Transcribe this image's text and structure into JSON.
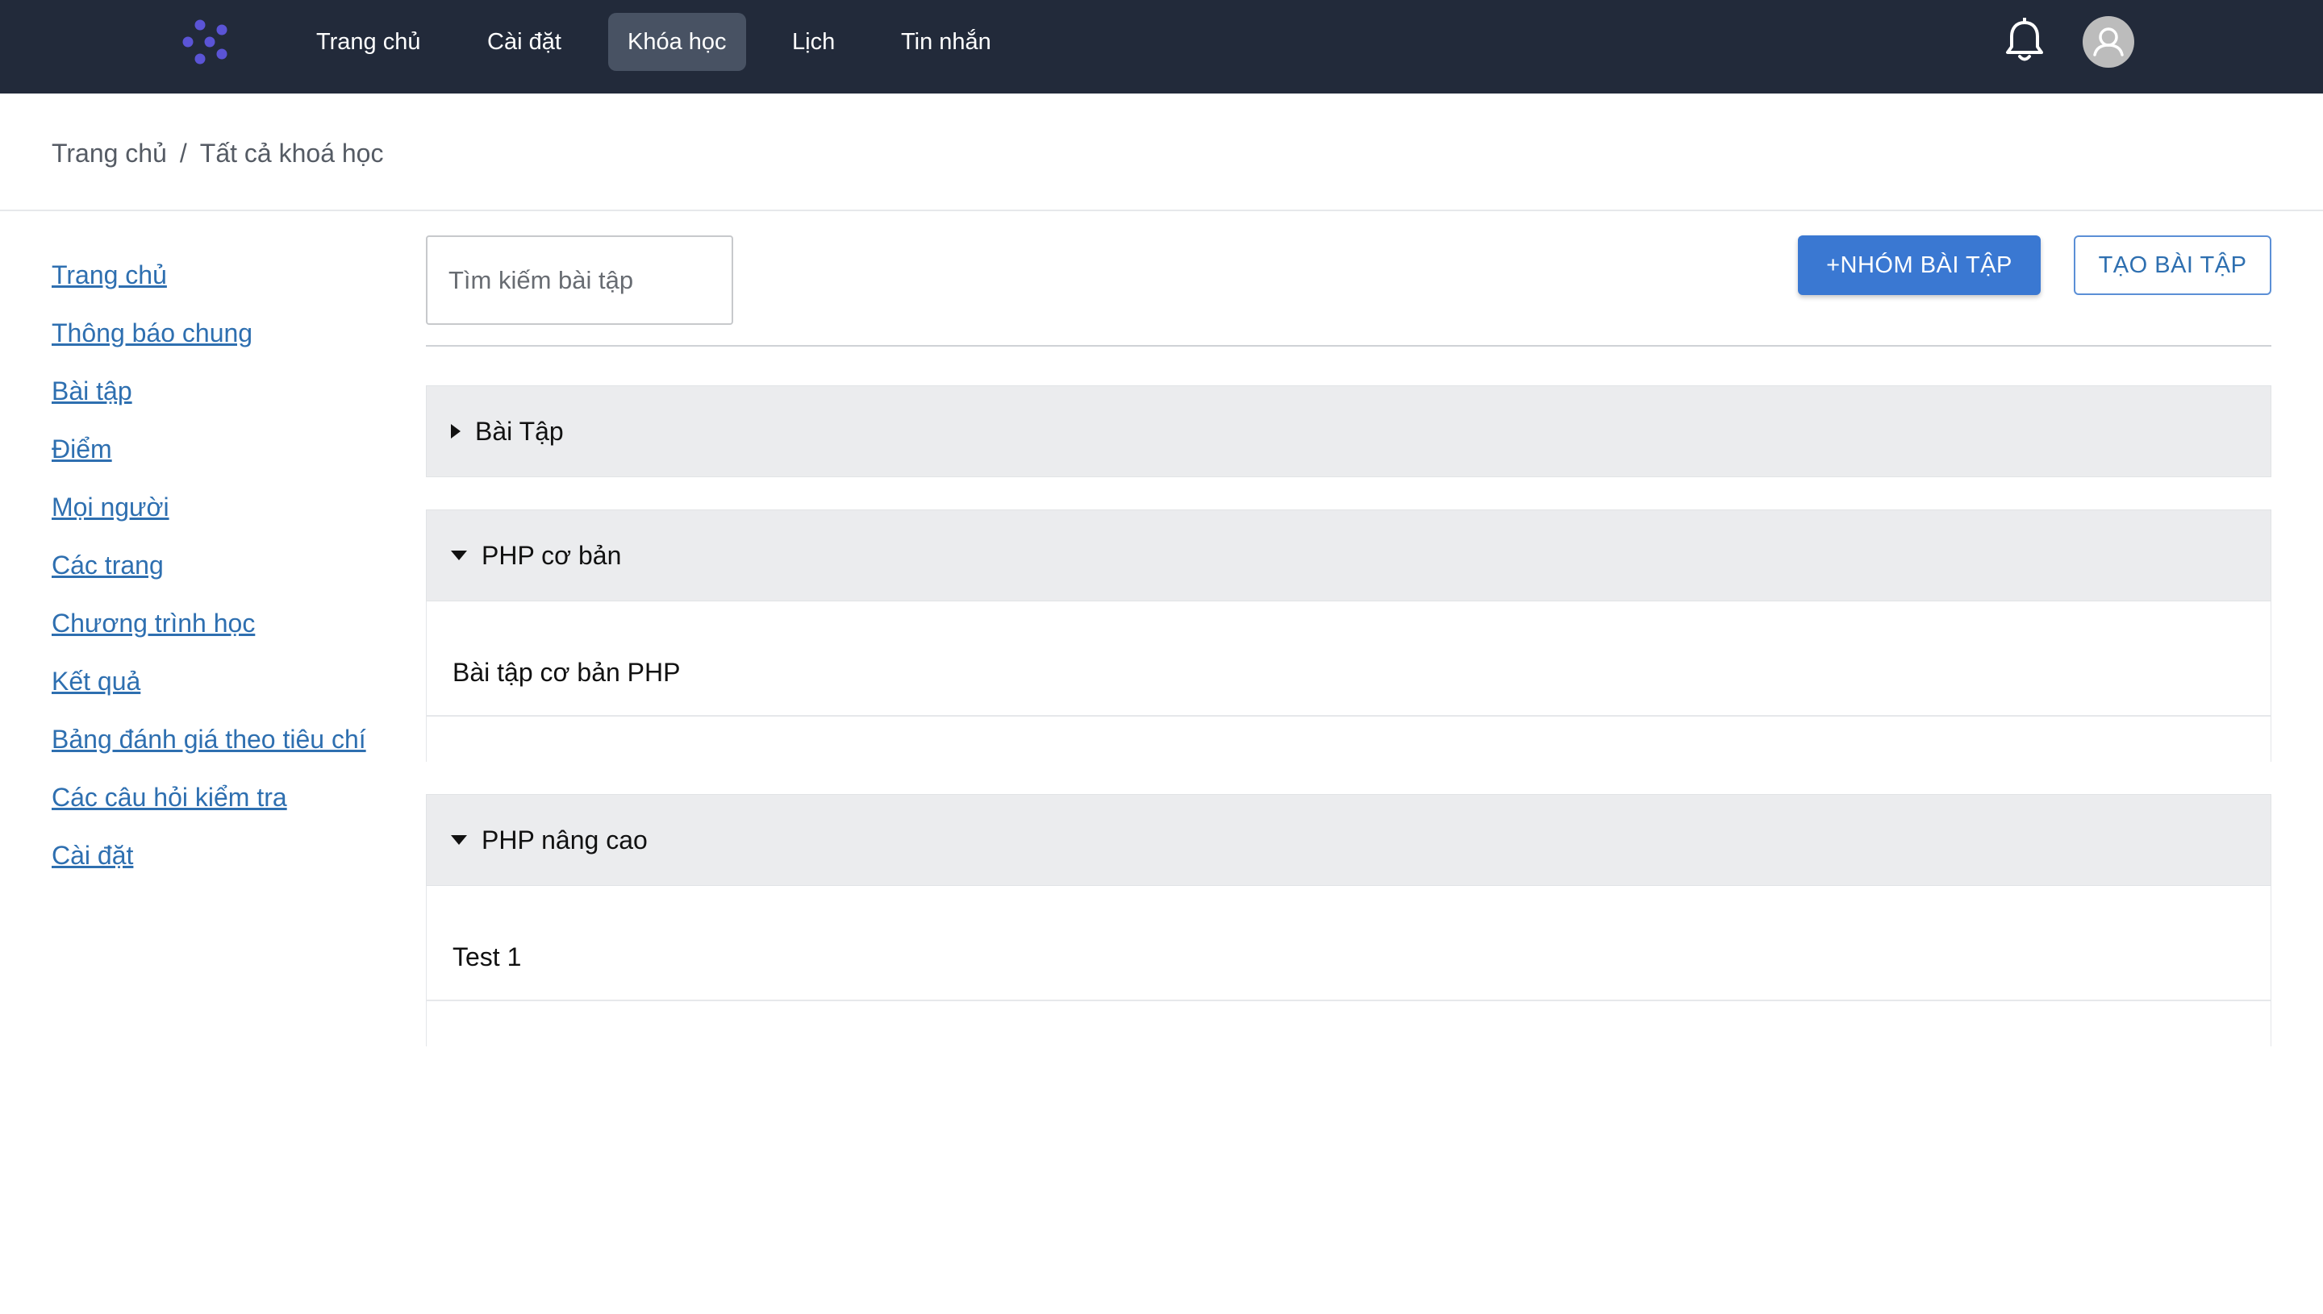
{
  "nav": {
    "items": [
      {
        "label": "Trang chủ",
        "active": false
      },
      {
        "label": "Cài đặt",
        "active": false
      },
      {
        "label": "Khóa học",
        "active": true
      },
      {
        "label": "Lịch",
        "active": false
      },
      {
        "label": "Tin nhắn",
        "active": false
      }
    ],
    "icons": {
      "logo": "logo-icon",
      "bell": "bell-icon",
      "avatar": "user-avatar-icon"
    }
  },
  "breadcrumb": {
    "items": [
      "Trang chủ",
      "Tất cả khoá học"
    ],
    "separator": "/"
  },
  "sidebar": {
    "items": [
      "Trang chủ",
      "Thông báo chung",
      "Bài tập",
      "Điểm",
      "Mọi người",
      "Các trang",
      "Chương trình học",
      "Kết quả",
      "Bảng đánh giá theo tiêu chí",
      "Các câu hỏi kiểm tra",
      "Cài đặt"
    ]
  },
  "toolbar": {
    "search_placeholder": "Tìm kiếm bài tập",
    "add_group_label": "+NHÓM BÀI TẬP",
    "create_assignment_label": "TẠO BÀI TẬP"
  },
  "groups": [
    {
      "title": "Bài Tập",
      "expanded": false,
      "items": []
    },
    {
      "title": "PHP cơ bản",
      "expanded": true,
      "items": [
        "Bài tập cơ bản PHP"
      ]
    },
    {
      "title": "PHP nâng cao",
      "expanded": true,
      "items": [
        "Test 1"
      ]
    }
  ],
  "colors": {
    "topbar": "#222a3a",
    "nav_active": "#485263",
    "link": "#2e6fb0",
    "primary_button": "#3a78d2",
    "group_header": "#ebecee",
    "logo": "#5b54d6"
  }
}
